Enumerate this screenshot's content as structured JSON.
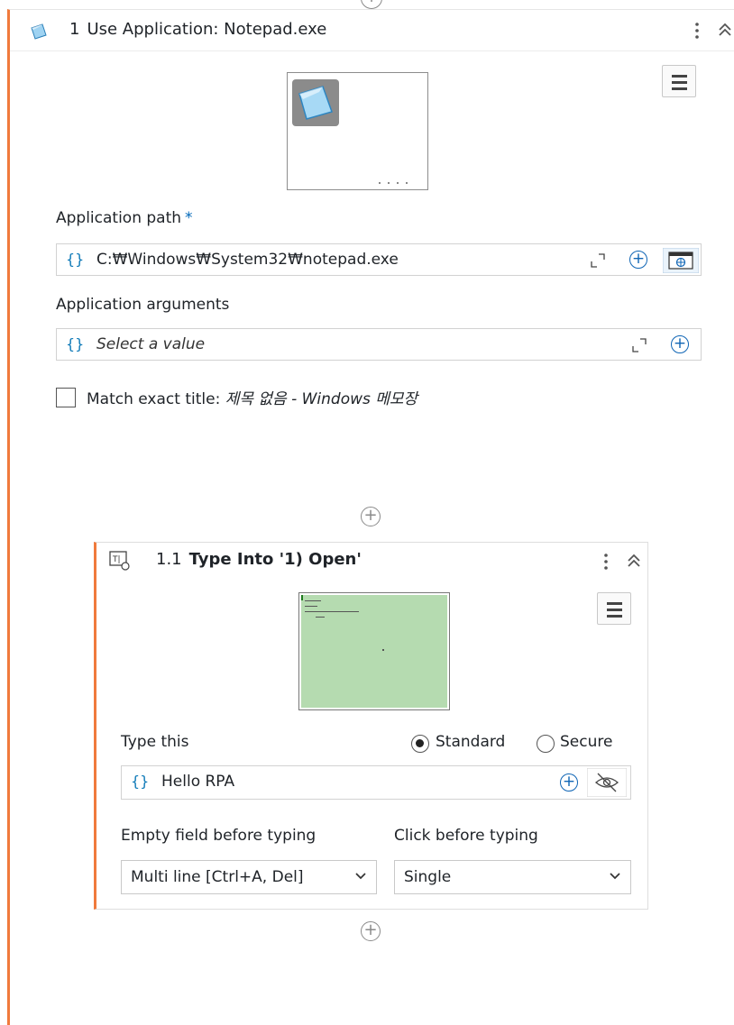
{
  "activity": {
    "number": "1",
    "title": "Use Application: Notepad.exe",
    "application_path_label": "Application path",
    "application_path_required": "*",
    "application_path_value": "C:₩Windows₩System32₩notepad.exe",
    "application_arguments_label": "Application arguments",
    "application_arguments_placeholder": "Select a value",
    "match_exact_title_label": "Match exact title:",
    "match_exact_title_value": "제목 없음 - Windows 메모장",
    "match_exact_title_checked": false,
    "braces": "{}"
  },
  "child_activity": {
    "number": "1.1",
    "title_prefix": "Type Into '1) Open'",
    "type_this_label": "Type this",
    "mode_standard": "Standard",
    "mode_secure": "Secure",
    "mode_selected": "Standard",
    "type_value": "Hello RPA",
    "empty_field_label": "Empty field before typing",
    "empty_field_value": "Multi line [Ctrl+A, Del]",
    "click_before_label": "Click before typing",
    "click_before_value": "Single",
    "braces": "{}"
  },
  "colors": {
    "accent_orange": "#f07a3c",
    "link_blue": "#0f65b5",
    "thumb_green": "#b5dbb0"
  },
  "icons": {
    "header_app": "notepad-icon",
    "kebab": "kebab-icon",
    "collapse": "collapse-icon",
    "menu": "hamburger-icon",
    "expand": "expand-icon",
    "plus": "plus-circle-icon",
    "browser": "browser-icon",
    "hide": "eye-off-icon",
    "type_into": "type-into-icon",
    "chevron": "chevron-down-icon"
  }
}
